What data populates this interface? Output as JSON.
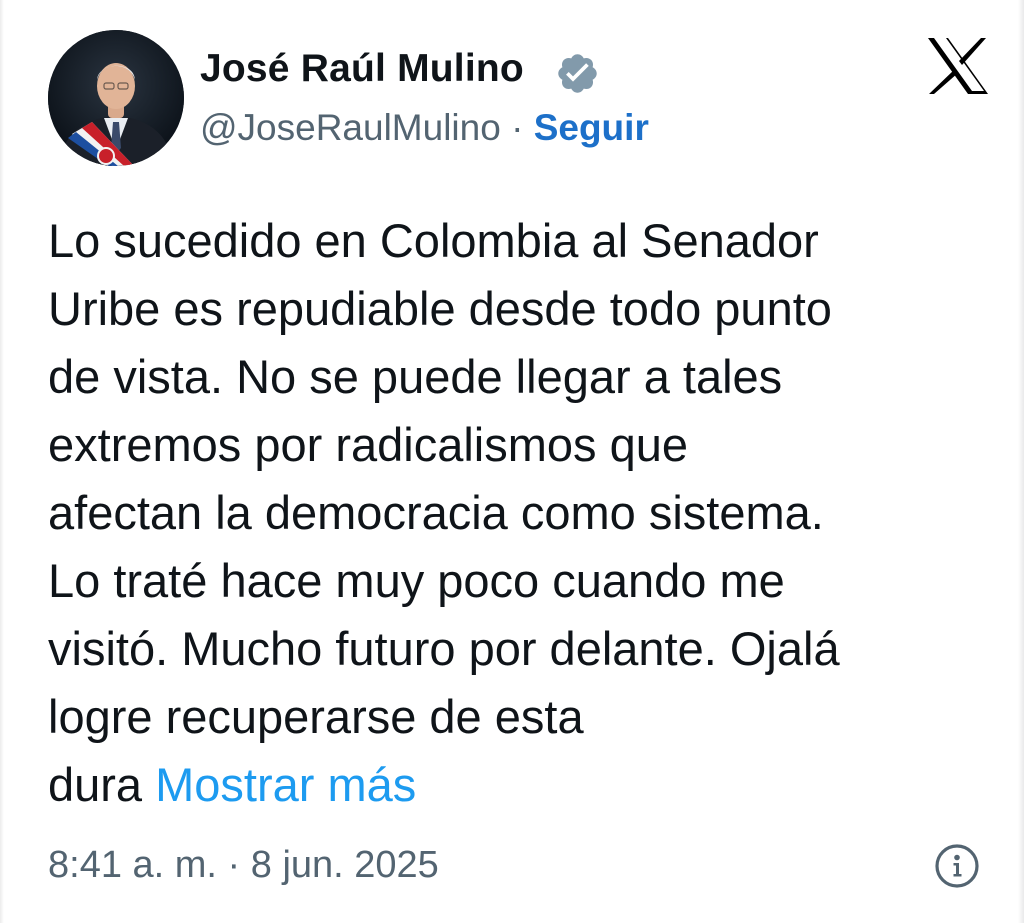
{
  "tweet": {
    "author": {
      "display_name": "José Raúl Mulino",
      "handle": "@JoseRaulMulino",
      "separator": "·",
      "follow_label": "Seguir",
      "avatar_icon": "profile-photo",
      "verified_icon": "verified-badge-icon"
    },
    "platform_icon": "x-logo-icon",
    "text_lines": [
      "Lo sucedido en Colombia al Senador",
      "Uribe es repudiable desde todo punto",
      "de vista. No se puede llegar a tales",
      "extremos por radicalismos que",
      "afectan la democracia como sistema.",
      "Lo traté hace muy poco cuando me",
      "visitó. Mucho futuro por delante. Ojalá",
      "logre recuperarse de esta",
      "dura"
    ],
    "show_more_label": "Mostrar más",
    "timestamp": "8:41 a. m. · 8 jun. 2025",
    "info_icon": "info-icon"
  },
  "colors": {
    "text_primary": "#0f1419",
    "text_secondary": "#536471",
    "link": "#1d9bf0",
    "follow": "#1d70c9"
  }
}
